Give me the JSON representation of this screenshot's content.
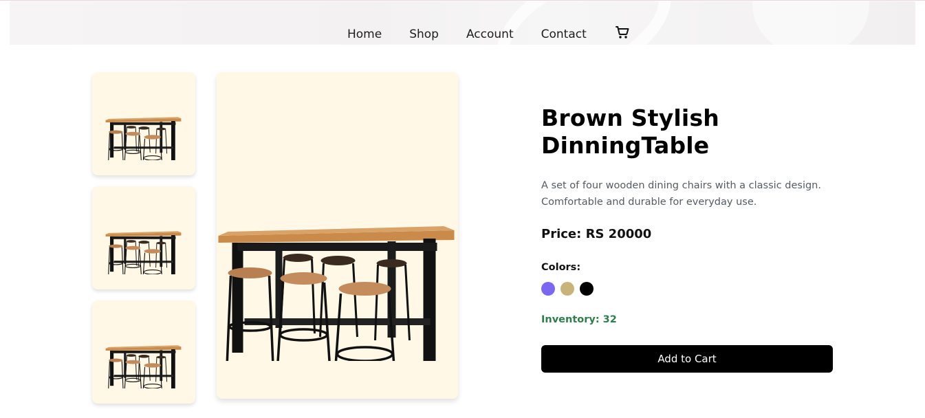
{
  "nav": {
    "links": [
      "Home",
      "Shop",
      "Account",
      "Contact"
    ],
    "cart_icon": "shopping-cart-icon"
  },
  "product": {
    "title": "Brown Stylish DinningTable",
    "description": "A set of four wooden dining chairs with a classic design. Comfortable and durable for everyday use.",
    "price_label": "Price: RS 20000",
    "colors_label": "Colors:",
    "colors": [
      "#7b68ee",
      "#c8b37a",
      "#000000"
    ],
    "inventory_label": "Inventory: 32",
    "add_to_cart_label": "Add to Cart"
  },
  "theme": {
    "thumb_bg": "#fff8e7",
    "inventory_color": "#2e7d4a",
    "button_bg": "#000000"
  }
}
